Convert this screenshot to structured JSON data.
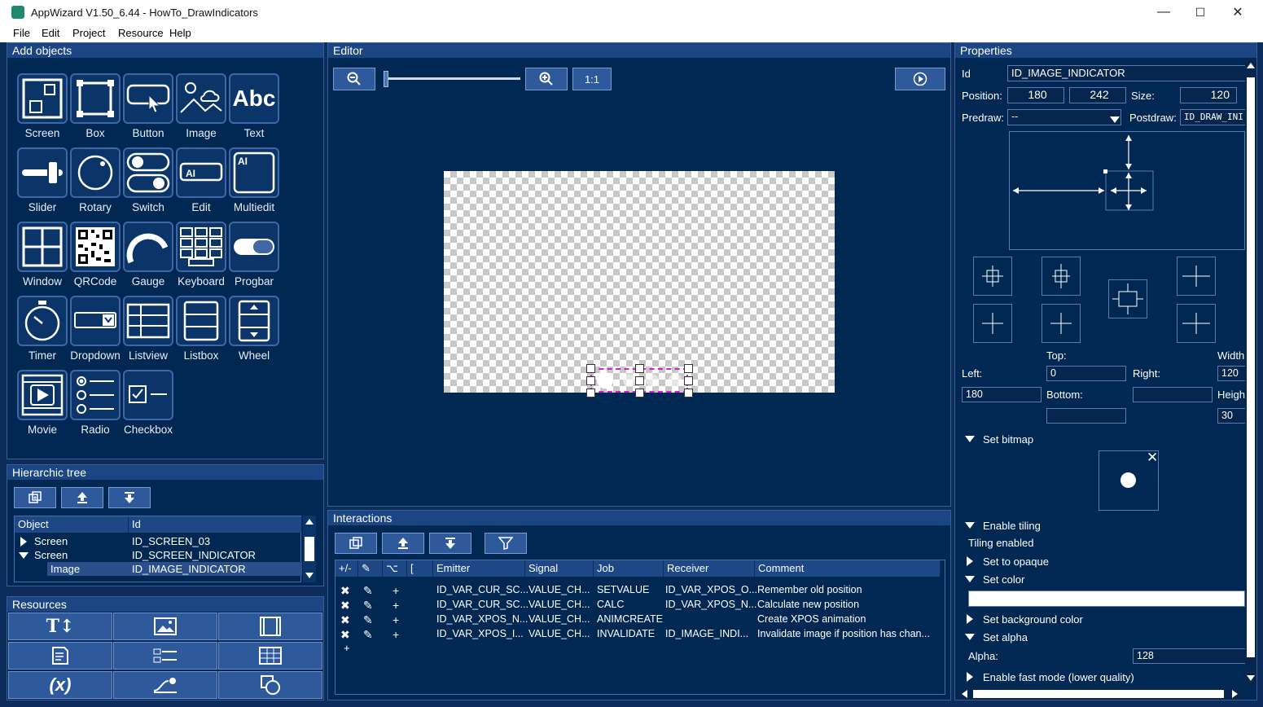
{
  "window": {
    "title": "AppWizard V1.50_6.44 - HowTo_DrawIndicators",
    "minimize": "—",
    "maximize": "☐",
    "close": "✕"
  },
  "menu": [
    "File",
    "Edit",
    "Project",
    "Resource",
    "Help"
  ],
  "add_objects": {
    "title": "Add objects",
    "items": [
      "Screen",
      "Box",
      "Button",
      "Image",
      "Text",
      "Slider",
      "Rotary",
      "Switch",
      "Edit",
      "Multiedit",
      "Window",
      "QRCode",
      "Gauge",
      "Keyboard",
      "Progbar",
      "Timer",
      "Dropdown",
      "Listview",
      "Listbox",
      "Wheel",
      "Movie",
      "Radio",
      "Checkbox"
    ]
  },
  "hier": {
    "title": "Hierarchic tree",
    "col_object": "Object",
    "col_id": "Id",
    "rows": [
      {
        "object": "Screen",
        "id": "ID_SCREEN_03",
        "expanded": false
      },
      {
        "object": "Screen",
        "id": "ID_SCREEN_INDICATOR",
        "expanded": true
      },
      {
        "object": "Image",
        "id": "ID_IMAGE_INDICATOR",
        "selected": true
      }
    ]
  },
  "resources": {
    "title": "Resources"
  },
  "editor": {
    "title": "Editor",
    "zoom_reset": "1:1",
    "zoom_level": 0
  },
  "interactions": {
    "title": "Interactions",
    "headers": [
      "+/-",
      "✎",
      "⌥",
      "[",
      "Emitter",
      "Signal",
      "Job",
      "Receiver",
      "Comment"
    ],
    "rows": [
      {
        "emitter": "ID_VAR_CUR_SC...",
        "signal": "VALUE_CH...",
        "job": "SETVALUE",
        "receiver": "ID_VAR_XPOS_O...",
        "comment": "Remember old position"
      },
      {
        "emitter": "ID_VAR_CUR_SC...",
        "signal": "VALUE_CH...",
        "job": "CALC",
        "receiver": "ID_VAR_XPOS_N...",
        "comment": "Calculate new position"
      },
      {
        "emitter": "ID_VAR_XPOS_N...",
        "signal": "VALUE_CH...",
        "job": "ANIMCREATE",
        "receiver": "",
        "comment": "Create XPOS animation"
      },
      {
        "emitter": "ID_VAR_XPOS_I...",
        "signal": "VALUE_CH...",
        "job": "INVALIDATE",
        "receiver": "ID_IMAGE_INDI...",
        "comment": "Invalidate image if position has chan..."
      }
    ],
    "add_row": "+"
  },
  "properties": {
    "title": "Properties",
    "id_label": "Id",
    "id_value": "ID_IMAGE_INDICATOR",
    "position_label": "Position:",
    "pos_x": "180",
    "pos_y": "242",
    "size_label": "Size:",
    "size_w": "120",
    "predraw_label": "Predraw:",
    "predraw_value": "--",
    "postdraw_label": "Postdraw:",
    "postdraw_value": "ID_DRAW_INI",
    "top_label": "Top:",
    "width_label": "Width",
    "left_label": "Left:",
    "right_label": "Right:",
    "bottom_label": "Bottom:",
    "height_label": "Heigh",
    "top_value": "0",
    "left_value": "180",
    "width_value": "120",
    "height_value": "30",
    "sections": {
      "set_bitmap": "Set bitmap",
      "enable_tiling": "Enable tiling",
      "tiling_enabled": "Tiling enabled",
      "set_opaque": "Set to opaque",
      "set_color": "Set color",
      "set_bg_color": "Set background color",
      "set_alpha": "Set alpha",
      "alpha_label": "Alpha:",
      "alpha_value": "128",
      "fast_mode": "Enable fast mode (lower quality)"
    }
  }
}
